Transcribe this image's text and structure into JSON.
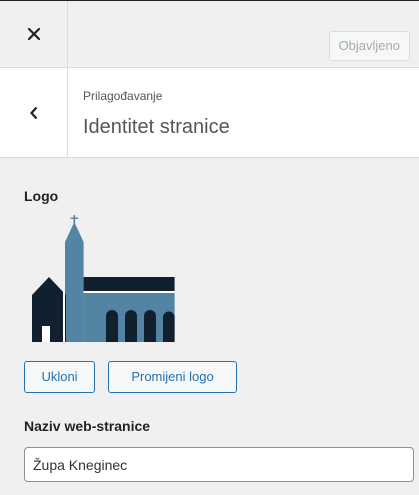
{
  "header": {
    "close_icon": "close-icon",
    "publish_label": "Objavljeno"
  },
  "section": {
    "back_icon": "chevron-left-icon",
    "breadcrumb": "Prilagođavanje",
    "title": "Identitet stranice"
  },
  "logo": {
    "label": "Logo",
    "image_icon": "church-logo",
    "colors": {
      "dark": "#10202e",
      "blue": "#5384a3",
      "white": "#ffffff"
    },
    "remove_label": "Ukloni",
    "change_label": "Promijeni logo"
  },
  "site_title": {
    "label": "Naziv web-stranice",
    "value": "Župa Kneginec"
  },
  "colors": {
    "accent": "#2271b1",
    "background": "#f0f0f1",
    "text": "#1d2327"
  }
}
